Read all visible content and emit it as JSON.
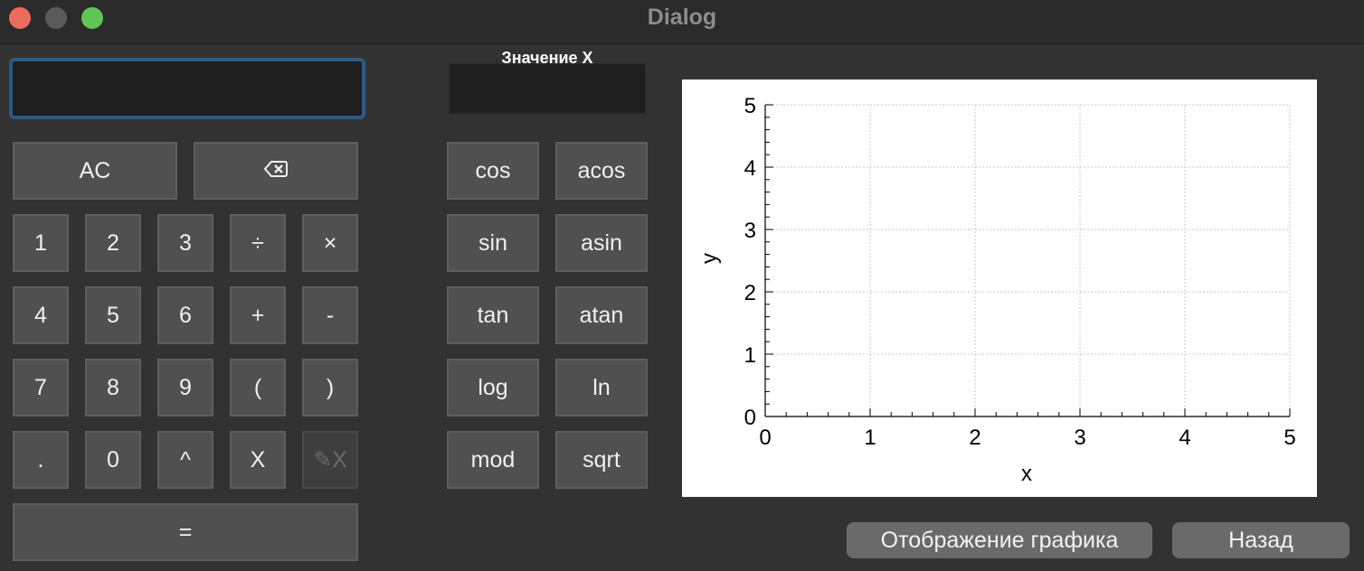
{
  "window": {
    "title": "Dialog"
  },
  "expression": {
    "value": ""
  },
  "x_value": {
    "label": "Значение X",
    "value": ""
  },
  "buttons": {
    "ac": "AC",
    "backspace": "⌫",
    "one": "1",
    "two": "2",
    "three": "3",
    "divide": "÷",
    "multiply": "×",
    "four": "4",
    "five": "5",
    "six": "6",
    "plus": "+",
    "minus": "-",
    "seven": "7",
    "eight": "8",
    "nine": "9",
    "lparen": "(",
    "rparen": ")",
    "dot": ".",
    "zero": "0",
    "power": "^",
    "x": "X",
    "clear_x": "✎X",
    "equals": "=",
    "cos": "cos",
    "acos": "acos",
    "sin": "sin",
    "asin": "asin",
    "tan": "tan",
    "atan": "atan",
    "log": "log",
    "ln": "ln",
    "mod": "mod",
    "sqrt": "sqrt"
  },
  "actions": {
    "plot": "Отображение графика",
    "back": "Назад"
  },
  "chart_data": {
    "type": "line",
    "title": "",
    "xlabel": "x",
    "ylabel": "y",
    "xlim": [
      0,
      5
    ],
    "ylim": [
      0,
      5
    ],
    "x_ticks": [
      "0",
      "1",
      "2",
      "3",
      "4",
      "5"
    ],
    "y_ticks": [
      "0",
      "1",
      "2",
      "3",
      "4",
      "5"
    ],
    "grid": true,
    "series": []
  }
}
